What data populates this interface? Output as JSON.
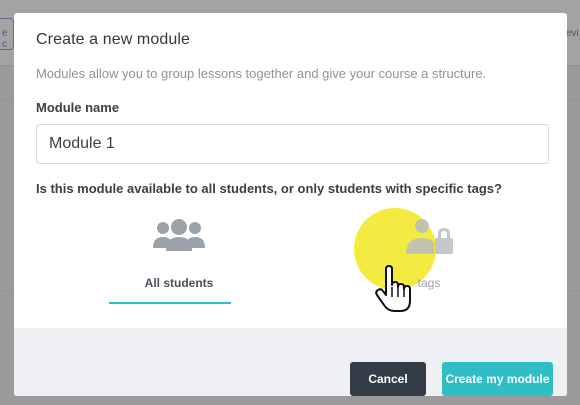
{
  "background": {
    "left_tab_text": "e c",
    "right_text": "evi"
  },
  "modal": {
    "title": "Create a new module",
    "description": "Modules allow you to group lessons together and give your course a structure.",
    "name_label": "Module name",
    "name_value": "Module 1",
    "question": "Is this module available to all students, or only students with specific tags?",
    "options": [
      {
        "label": "All students",
        "icon": "users-group-icon",
        "selected": true
      },
      {
        "label": "tags",
        "icon": "user-lock-icon",
        "selected": false
      }
    ],
    "buttons": {
      "cancel": "Cancel",
      "create": "Create my module"
    }
  },
  "colors": {
    "accent": "#2fbdc6",
    "dark_button": "#343c47",
    "highlight": "#f2e828"
  }
}
